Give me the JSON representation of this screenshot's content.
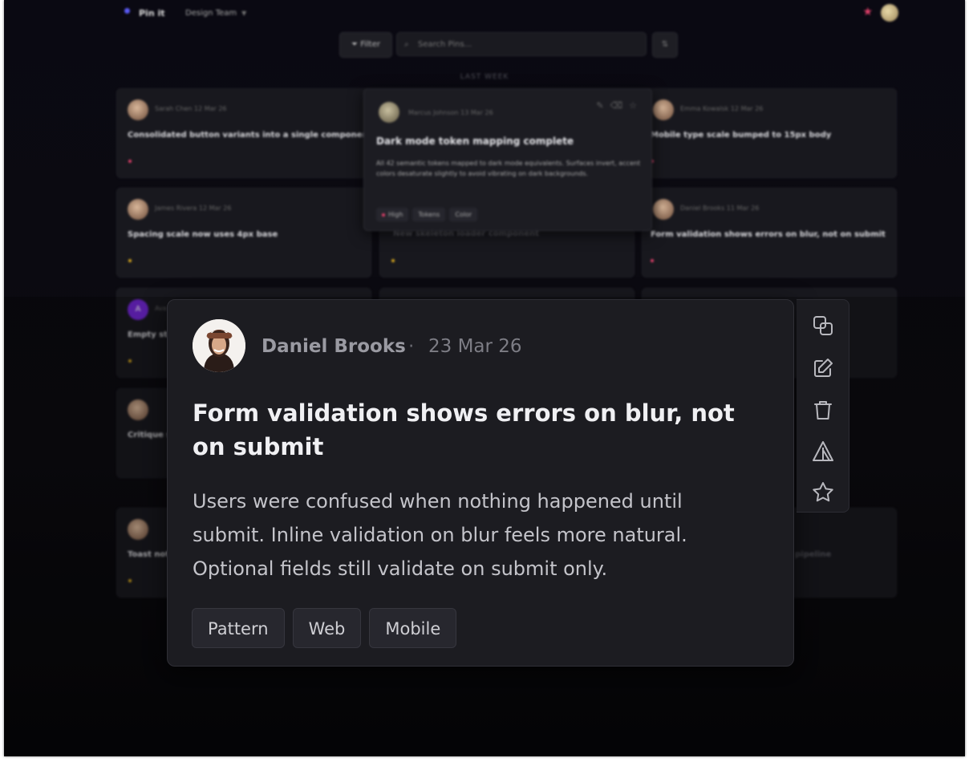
{
  "header": {
    "app_name": "Pin it",
    "team": "Design Team"
  },
  "toolbar": {
    "filter_label": "Filter",
    "search_placeholder": "Search Pins...",
    "section_label": "LAST WEEK"
  },
  "cards": [
    {
      "author": "Sarah Chen",
      "date": "12 Mar 26",
      "title": "Consolidated button variants into a single component",
      "priority": "red"
    },
    {
      "author": "Emma Kowalsk",
      "date": "12 Mar 26",
      "title": "Mobile type scale bumped to 15px body",
      "priority": "red"
    },
    {
      "author": "James Rivera",
      "date": "12 Mar 26",
      "title": "Spacing scale now uses 4px base",
      "priority": "yellow"
    },
    {
      "author": "Daniel Brooks",
      "date": "11 Mar 26",
      "title": "Form validation shows errors on blur, not on submit",
      "priority": "red"
    },
    {
      "author": "Ava",
      "avatar_letter": "A",
      "title": "Empty sta",
      "priority": "yellow"
    },
    {
      "author": "",
      "title": "Critique se",
      "priority": ""
    },
    {
      "author": "",
      "title": "Toast noti",
      "priority": "yellow"
    }
  ],
  "hover_card": {
    "author": "Marcus Johnson",
    "date": "13 Mar 26",
    "title": "Dark mode token mapping complete",
    "body": "All 42 semantic tokens mapped to dark mode equivalents. Surfaces invert, accent colors desaturate slightly to avoid vibrating on dark backgrounds.",
    "tags": [
      "High",
      "Tokens",
      "Color"
    ]
  },
  "faded_titles": {
    "middle_card": "New skeleton loader component",
    "right_partial": "pipeline"
  },
  "expanded": {
    "author": "Daniel Brooks",
    "separator": "·",
    "date": "23 Mar 26",
    "title": "Form validation shows errors on blur, not on submit",
    "body": "Users were confused when nothing happened until submit. Inline validation on blur feels more natural. Optional fields still validate on submit only.",
    "tags": [
      "Pattern",
      "Web",
      "Mobile"
    ]
  },
  "actions": [
    "copy-icon",
    "edit-icon",
    "trash-icon",
    "warning-icon",
    "star-icon"
  ],
  "colors": {
    "accent": "#5b5bf5",
    "priority_high": "#e0406a",
    "priority_medium": "#d8a81e",
    "background": "#0b0a10",
    "card": "#18181e"
  }
}
